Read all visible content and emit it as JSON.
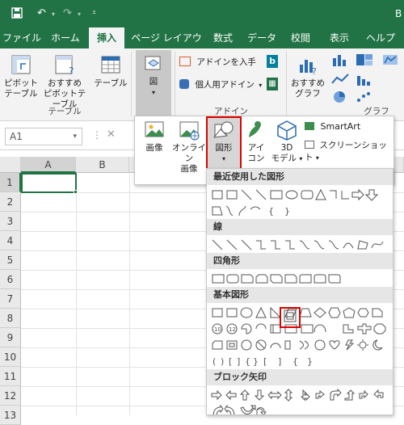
{
  "title_right": "B",
  "tabs": [
    "ファイル",
    "ホーム",
    "挿入",
    "ページ レイアウト",
    "数式",
    "データ",
    "校閲",
    "表示",
    "ヘルプ"
  ],
  "active_tab": "挿入",
  "ribbon": {
    "pivot_table": "ピボット\nテーブル",
    "recommended_pivot": "おすすめ\nピボットテーブル",
    "table": "テーブル",
    "group_table": "テーブル",
    "illustrations": "図",
    "get_addins": "アドインを入手",
    "my_addins": "個人用アドイン",
    "group_addins": "アドイン",
    "recommended_charts": "おすすめ\nグラフ",
    "group_charts": "グラフ"
  },
  "namebox": "A1",
  "columns": [
    "A",
    "B"
  ],
  "rows": [
    "1",
    "2",
    "3",
    "4",
    "5",
    "6",
    "7",
    "8",
    "9",
    "10",
    "11",
    "12",
    "13"
  ],
  "illustrations_menu": {
    "picture": "画像",
    "online_picture": "オンライン\n画像",
    "shapes": "図形",
    "icons": "アイ\nコン",
    "models_3d": "3D\nモデル",
    "smartart": "SmartArt",
    "screenshot": "スクリーンショット"
  },
  "shapes_panel": {
    "recent": "最近使用した図形",
    "lines": "線",
    "rectangles": "四角形",
    "basic": "基本図形",
    "block_arrows": "ブロック矢印"
  },
  "accent_color": "#217346",
  "highlight_color": "#e00000"
}
